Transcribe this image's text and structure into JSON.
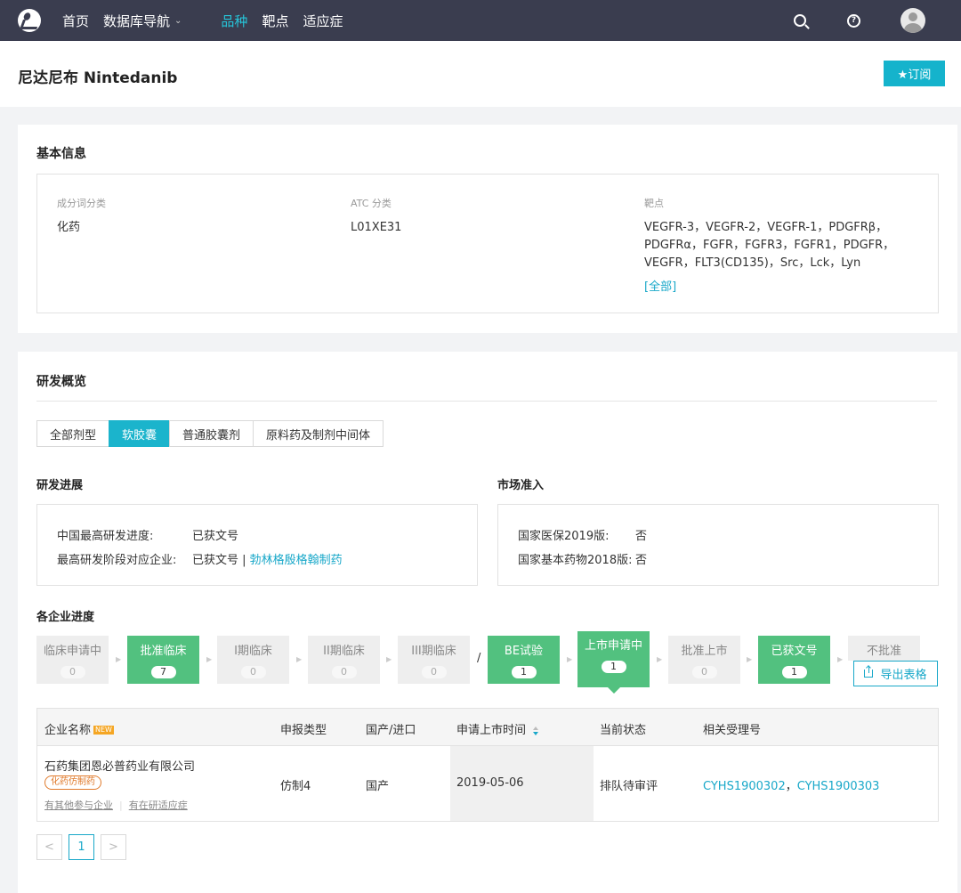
{
  "nav": {
    "items": [
      {
        "label": "首页"
      },
      {
        "label": "数据库导航"
      },
      {
        "label": "品种"
      },
      {
        "label": "靶点"
      },
      {
        "label": "适应症"
      }
    ]
  },
  "header": {
    "title": "尼达尼布 Nintedanib",
    "subscribe_label": "★订阅"
  },
  "basic_info": {
    "title": "基本信息",
    "category_label": "成分词分类",
    "category_value": "化药",
    "atc_label": "ATC 分类",
    "atc_value": "L01XE31",
    "target_label": "靶点",
    "target_line1": "VEGFR-3，VEGFR-2，VEGFR-1，PDGFRβ，",
    "target_line2": "PDGFRα，FGFR，FGFR3，FGFR1，PDGFR，",
    "target_line3": "VEGFR，FLT3(CD135)，Src，Lck，Lyn",
    "all_link": "[全部]"
  },
  "overview": {
    "title": "研发概览",
    "tabs": [
      {
        "label": "全部剂型"
      },
      {
        "label": "软胶囊"
      },
      {
        "label": "普通胶囊剂"
      },
      {
        "label": "原料药及制剂中间体"
      }
    ],
    "progress_title": "研发进展",
    "market_title": "市场准入",
    "progress": {
      "highest_label": "中国最高研发进度:",
      "highest_value": "已获文号",
      "company_label": "最高研发阶段对应企业:",
      "company_status": "已获文号 |",
      "company_link": "勃林格殷格翰制药"
    },
    "market": {
      "nrdl_label": "国家医保2019版:",
      "nrdl_value": "否",
      "eml_label": "国家基本药物2018版:",
      "eml_value": "否"
    },
    "company_progress_title": "各企业进度",
    "stages": [
      {
        "label": "临床申请中",
        "count": "0"
      },
      {
        "label": "批准临床",
        "count": "7"
      },
      {
        "label": "I期临床",
        "count": "0"
      },
      {
        "label": "II期临床",
        "count": "0"
      },
      {
        "label": "III期临床",
        "count": "0"
      },
      {
        "label": "BE试验",
        "count": "1"
      },
      {
        "label": "上市申请中",
        "count": "1"
      },
      {
        "label": "批准上市",
        "count": "0"
      },
      {
        "label": "已获文号",
        "count": "1"
      },
      {
        "label": "不批准",
        "count": ""
      }
    ],
    "slash": "/",
    "export_label": "导出表格",
    "table": {
      "headers": [
        "企业名称",
        "申报类型",
        "国产/进口",
        "申请上市时间",
        "当前状态",
        "相关受理号"
      ],
      "new_badge": "NEW",
      "rows": [
        {
          "company": "石药集团恩必普药业有限公司",
          "tag": "化药仿制药",
          "link1": "有其他参与企业",
          "link2": "有在研适应症",
          "type": "仿制4",
          "origin": "国产",
          "date": "2019-05-06",
          "status": "排队待审评",
          "receipt1": "CYHS1900302",
          "receipt_sep": "，",
          "receipt2": "CYHS1900303"
        }
      ]
    },
    "pager": {
      "prev": "<",
      "current": "1",
      "next": ">"
    }
  }
}
